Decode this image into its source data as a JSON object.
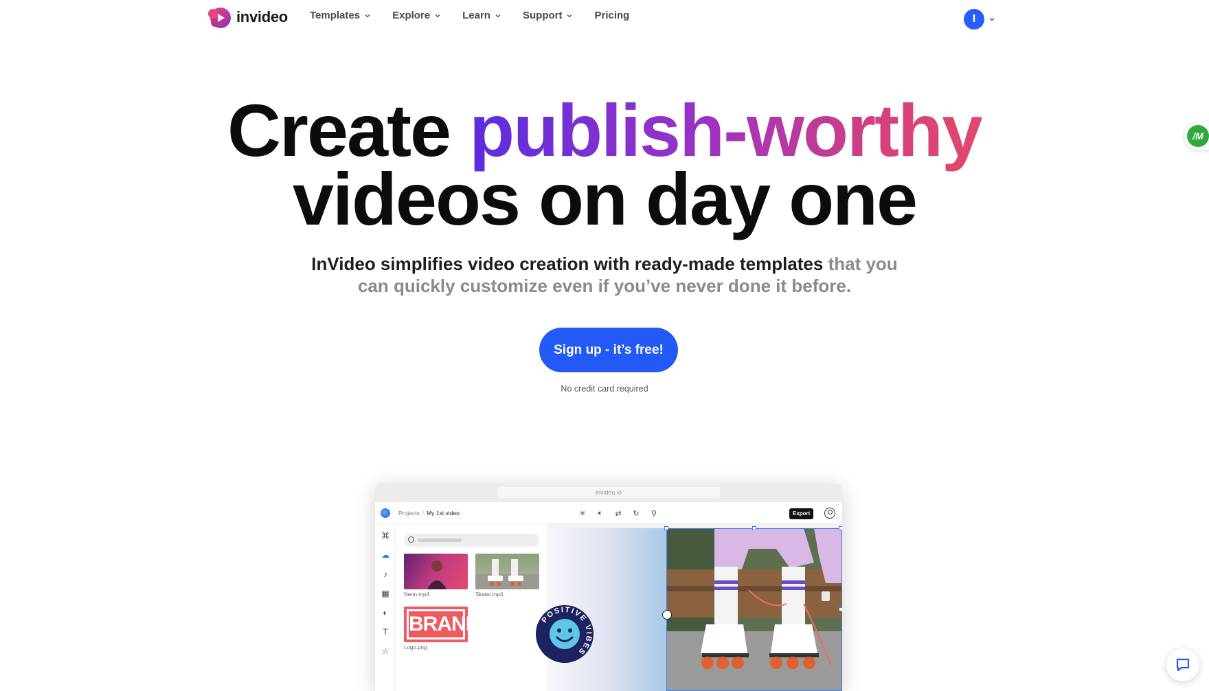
{
  "brand": {
    "name": "invideo"
  },
  "nav": {
    "items": [
      {
        "label": "Templates",
        "has_dropdown": true
      },
      {
        "label": "Explore",
        "has_dropdown": true
      },
      {
        "label": "Learn",
        "has_dropdown": true
      },
      {
        "label": "Support",
        "has_dropdown": true
      },
      {
        "label": "Pricing",
        "has_dropdown": false
      }
    ],
    "avatar_initial": "I"
  },
  "side_badge": {
    "label": "/M"
  },
  "hero": {
    "headline_plain": "Create ",
    "headline_gradient": "publish-worthy",
    "headline_line2": "videos on day one",
    "subhead_dark": "InVideo simplifies video creation with ready-made templates",
    "subhead_light": " that you can quickly customize even if you’ve never done it before.",
    "cta_label": "Sign up - it’s free!",
    "cta_note": "No credit card required"
  },
  "mockup": {
    "url": "invideo.io",
    "breadcrumb_root": "Projects",
    "breadcrumb_current": "My 1st video",
    "export_label": "Export",
    "media": [
      {
        "name": "Neon.mp4"
      },
      {
        "name": "Skater.mp4"
      },
      {
        "name": "Logo.png"
      }
    ],
    "logo_thumb_text": "BRAND",
    "sticker_text": "POSITIVE VIBES"
  },
  "colors": {
    "accent": "#2359f5",
    "gradient_start": "#5a2ee0",
    "gradient_end": "#e2486a",
    "brand_logo": "#c42b7a"
  }
}
